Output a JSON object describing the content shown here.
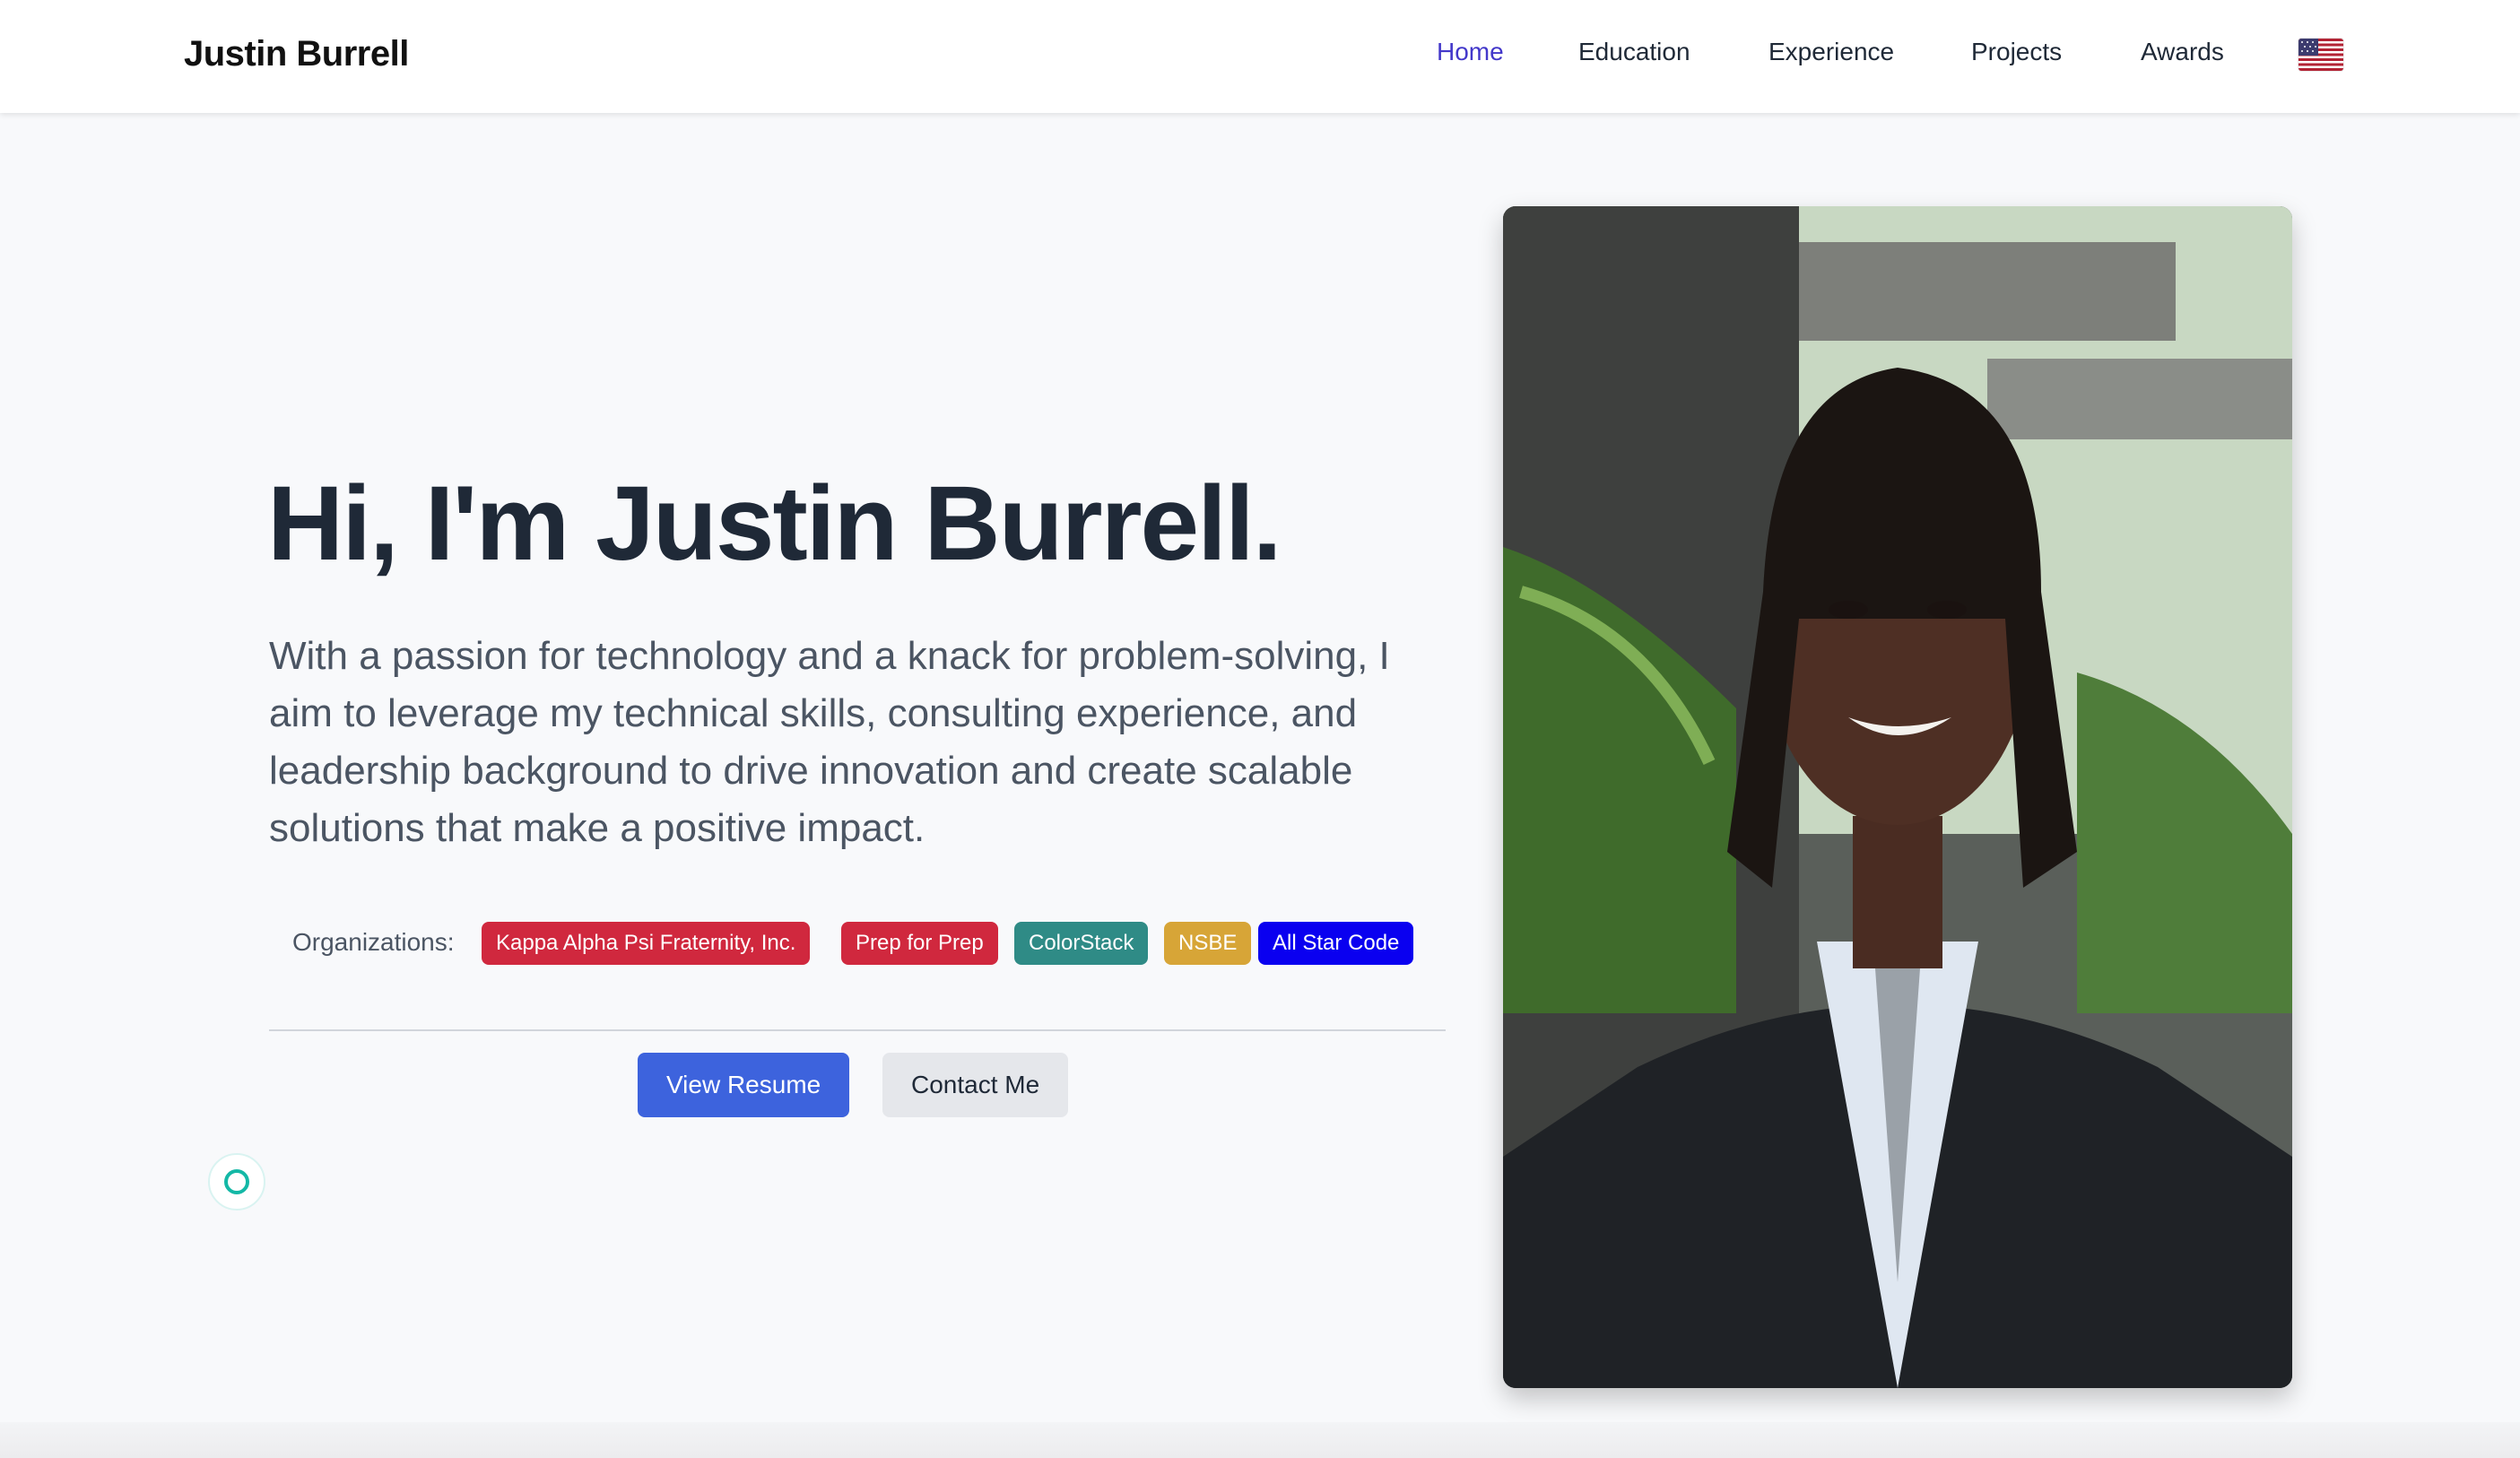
{
  "nav": {
    "brand": "Justin Burrell",
    "links": [
      {
        "label": "Home",
        "active": true
      },
      {
        "label": "Education",
        "active": false
      },
      {
        "label": "Experience",
        "active": false
      },
      {
        "label": "Projects",
        "active": false
      },
      {
        "label": "Awards",
        "active": false
      }
    ],
    "language_icon": "us-flag-icon"
  },
  "hero": {
    "title": "Hi, I'm Justin Burrell.",
    "description": "With a passion for technology and a knack for problem-solving, I aim to leverage my technical skills, consulting experience, and leadership background to drive innovation and create scalable solutions that make a positive impact.",
    "organizations_label": "Organizations:",
    "organizations": [
      {
        "label": "Kappa Alpha Psi Fraternity, Inc.",
        "color": "#d0283e"
      },
      {
        "label": "Prep for Prep",
        "color": "#d0283e"
      },
      {
        "label": "ColorStack",
        "color": "#2f8b86"
      },
      {
        "label": "NSBE",
        "color": "#d7a537"
      },
      {
        "label": "All Star Code",
        "color": "#0a00f0"
      }
    ],
    "primary_button": "View Resume",
    "secondary_button": "Contact Me"
  },
  "colors": {
    "accent": "#3d63dd",
    "nav_active": "#4338ca",
    "loader": "#14b8a6"
  },
  "icons": {
    "loader": "circle-loader-icon",
    "portrait": "portrait-photo"
  }
}
